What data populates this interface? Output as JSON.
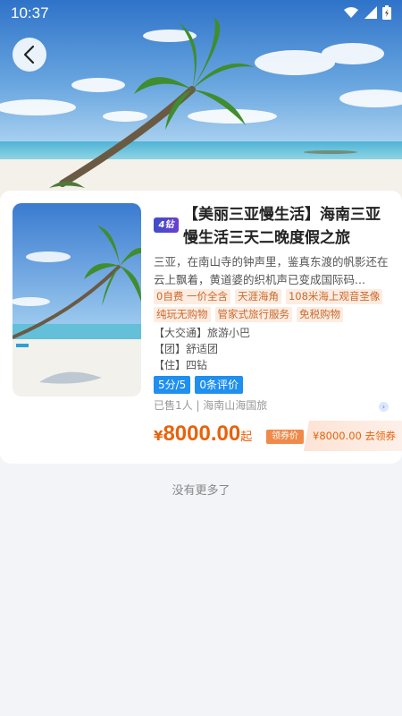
{
  "status_bar": {
    "time": "10:37",
    "icons": [
      "wifi-icon",
      "cell-signal-icon",
      "battery-icon"
    ]
  },
  "header": {
    "back_icon": "chevron-left-icon"
  },
  "product": {
    "level_badge": "4钻",
    "title": "【美丽三亚慢生活】海南三亚慢生活三天二晚度假之旅",
    "description": "三亚，在南山寺的钟声里，鉴真东渡的帆影还在云上飘着，黄道婆的织机声已变成国际码...",
    "tags": [
      "0自费 一价全含",
      "天涯海角",
      "108米海上观音圣像",
      "纯玩无购物",
      "管家式旅行服务",
      "免税购物"
    ],
    "info": [
      {
        "label": "【大交通】",
        "value": "旅游小巴"
      },
      {
        "label": "【团】",
        "value": "舒适团"
      },
      {
        "label": "【住】",
        "value": "四钻"
      }
    ],
    "rating_pill": "5分/5",
    "review_pill": "0条评价",
    "sold_text": "已售1人 | 海南山海国旅",
    "price_currency": "¥",
    "price_value": "8000.00",
    "price_suffix": "起",
    "coupon_label": "领券价",
    "coupon_text": "¥8000.00  去领券"
  },
  "footer_text": "没有更多了",
  "colors": {
    "accent": "#e8620b",
    "pill_blue": "#1f8ff0",
    "tag_bg": "#fdece1"
  }
}
